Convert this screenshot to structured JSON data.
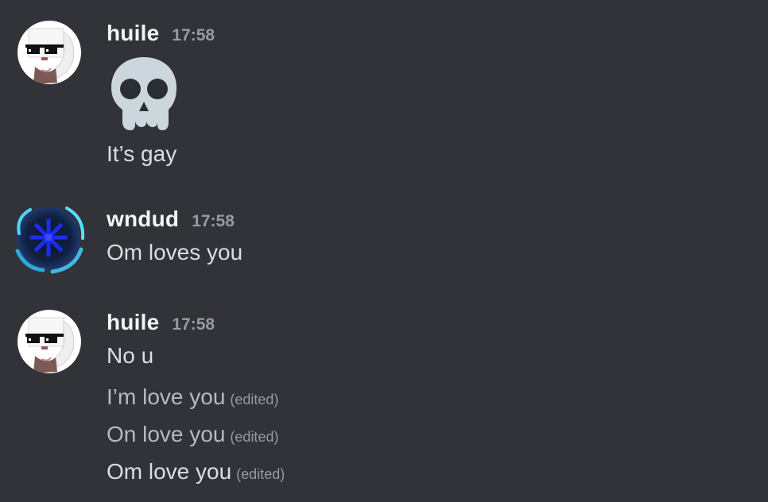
{
  "messages": [
    {
      "username": "huile",
      "time": "17:58",
      "avatar_icon": "sunglasses-cat-avatar",
      "emoji": "skull-emoji",
      "lines": [
        "It’s gay"
      ]
    },
    {
      "username": "wndud",
      "time": "17:58",
      "avatar_icon": "blue-swirl-avatar",
      "lines": [
        "Om loves you"
      ]
    },
    {
      "username": "huile",
      "time": "17:58",
      "avatar_icon": "sunglasses-cat-avatar",
      "lines": [
        {
          "text": "No u",
          "edited": ""
        },
        {
          "text": "I’m love you",
          "edited": "(edited)"
        },
        {
          "text": "On love you",
          "edited": "(edited)"
        },
        {
          "text": "Om love you",
          "edited": "(edited)"
        }
      ]
    }
  ],
  "colors": {
    "background": "#313338",
    "username": "#f2f3f5",
    "text": "#dbdee1",
    "muted": "#949ba4"
  }
}
